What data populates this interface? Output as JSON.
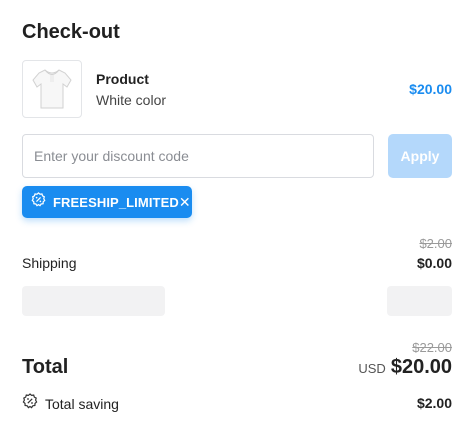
{
  "page": {
    "title": "Check-out"
  },
  "product": {
    "name": "Product",
    "variant": "White color",
    "price": "$20.00",
    "image_icon": "white-shirt"
  },
  "discount": {
    "placeholder": "Enter your discount code",
    "value": "",
    "apply_label": "Apply",
    "apply_color": "#b4d8fb"
  },
  "coupon": {
    "code": "FREESHIP_LIMITED",
    "icon": "discount-badge-icon",
    "close_icon": "close-icon",
    "color": "#1a8cf0"
  },
  "shipping": {
    "label": "Shipping",
    "original": "$2.00",
    "value": "$0.00"
  },
  "total": {
    "label": "Total",
    "original": "$22.00",
    "currency": "USD",
    "value": "$20.00"
  },
  "saving": {
    "label": "Total saving",
    "value": "$2.00",
    "icon": "discount-badge-icon"
  },
  "colors": {
    "accent": "#1a8cf0",
    "text": "#222222",
    "muted": "#9a9a9a"
  }
}
